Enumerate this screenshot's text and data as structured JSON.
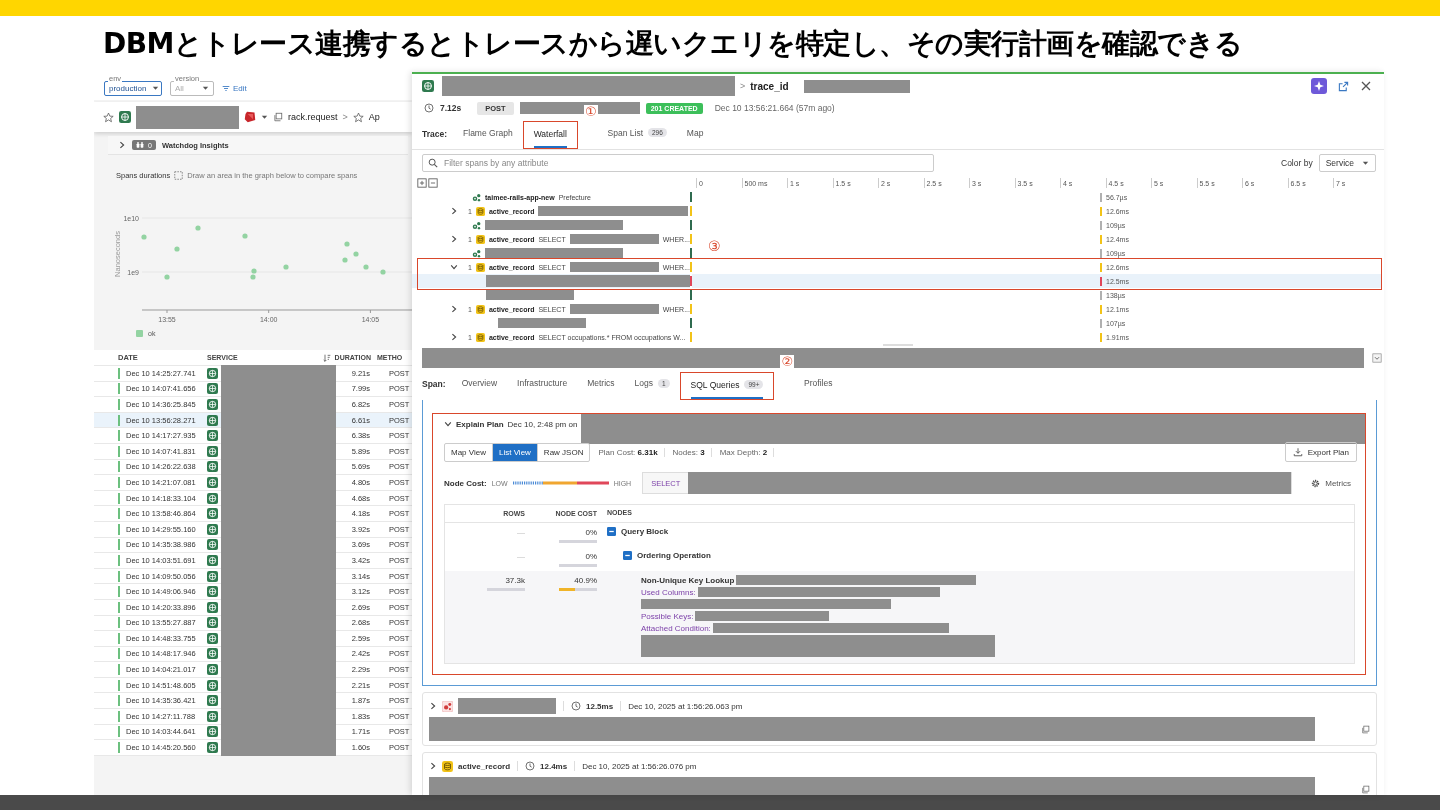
{
  "slide": {
    "title": "DBMとトレース連携するとトレースから遅いクエリを特定し、その実行計画を確認できる"
  },
  "filters": {
    "env": {
      "label": "env",
      "value": "production"
    },
    "version": {
      "label": "version",
      "value": "All"
    },
    "edit": "Edit"
  },
  "service_header": {
    "operation": "rack.request",
    "separator": ">",
    "next": "Ap"
  },
  "watchdog": {
    "count": "0",
    "label": "Watchdog Insights"
  },
  "spans_chart": {
    "title": "Spans durations",
    "hint": "Draw an area in the graph below to compare spans",
    "y_label": "Nanoseconds",
    "y_ticks": [
      "1e10",
      "1e9"
    ],
    "x_ticks": [
      "13:55",
      "14:00",
      "14:05"
    ],
    "legend": [
      {
        "name": "ok",
        "color": "#93d3a2"
      }
    ]
  },
  "traces_table": {
    "columns": [
      "DATE",
      "SERVICE",
      "DURATION",
      "METHO"
    ],
    "rows": [
      {
        "date": "Dec 10 14:25:27.741",
        "duration": "9.21s",
        "method": "POST",
        "selected": false
      },
      {
        "date": "Dec 10 14:07:41.656",
        "duration": "7.99s",
        "method": "POST",
        "selected": false
      },
      {
        "date": "Dec 10 14:36:25.845",
        "duration": "6.82s",
        "method": "POST",
        "selected": false
      },
      {
        "date": "Dec 10 13:56:28.271",
        "duration": "6.61s",
        "method": "POST",
        "selected": true
      },
      {
        "date": "Dec 10 14:17:27.935",
        "duration": "6.38s",
        "method": "POST",
        "selected": false
      },
      {
        "date": "Dec 10 14:07:41.831",
        "duration": "5.89s",
        "method": "POST",
        "selected": false
      },
      {
        "date": "Dec 10 14:26:22.638",
        "duration": "5.69s",
        "method": "POST",
        "selected": false
      },
      {
        "date": "Dec 10 14:21:07.081",
        "duration": "4.80s",
        "method": "POST",
        "selected": false
      },
      {
        "date": "Dec 10 14:18:33.104",
        "duration": "4.68s",
        "method": "POST",
        "selected": false
      },
      {
        "date": "Dec 10 13:58:46.864",
        "duration": "4.18s",
        "method": "POST",
        "selected": false
      },
      {
        "date": "Dec 10 14:29:55.160",
        "duration": "3.92s",
        "method": "POST",
        "selected": false
      },
      {
        "date": "Dec 10 14:35:38.986",
        "duration": "3.69s",
        "method": "POST",
        "selected": false
      },
      {
        "date": "Dec 10 14:03:51.691",
        "duration": "3.42s",
        "method": "POST",
        "selected": false
      },
      {
        "date": "Dec 10 14:09:50.056",
        "duration": "3.14s",
        "method": "POST",
        "selected": false
      },
      {
        "date": "Dec 10 14:49:06.946",
        "duration": "3.12s",
        "method": "POST",
        "selected": false
      },
      {
        "date": "Dec 10 14:20:33.896",
        "duration": "2.69s",
        "method": "POST",
        "selected": false
      },
      {
        "date": "Dec 10 13:55:27.887",
        "duration": "2.68s",
        "method": "POST",
        "selected": false
      },
      {
        "date": "Dec 10 14:48:33.755",
        "duration": "2.59s",
        "method": "POST",
        "selected": false
      },
      {
        "date": "Dec 10 14:48:17.946",
        "duration": "2.42s",
        "method": "POST",
        "selected": false
      },
      {
        "date": "Dec 10 14:04:21.017",
        "duration": "2.29s",
        "method": "POST",
        "selected": false
      },
      {
        "date": "Dec 10 14:51:48.605",
        "duration": "2.21s",
        "method": "POST",
        "selected": false
      },
      {
        "date": "Dec 10 14:35:36.421",
        "duration": "1.87s",
        "method": "POST",
        "selected": false
      },
      {
        "date": "Dec 10 14:27:11.788",
        "duration": "1.83s",
        "method": "POST",
        "selected": false
      },
      {
        "date": "Dec 10 14:03:44.641",
        "duration": "1.71s",
        "method": "POST",
        "selected": false
      },
      {
        "date": "Dec 10 14:45:20.560",
        "duration": "1.60s",
        "method": "POST",
        "selected": false
      }
    ]
  },
  "trace_panel": {
    "header": {
      "separator": ">",
      "trace_label": "trace_id"
    },
    "summary": {
      "duration": "7.12s",
      "method": "POST",
      "status": "201 CREATED",
      "timestamp": "Dec 10 13:56:21.664 (57m ago)"
    },
    "trace_tabs": {
      "label": "Trace:",
      "tabs": [
        {
          "label": "Flame Graph",
          "selected": false
        },
        {
          "label": "Waterfall",
          "selected": true,
          "annotation": "①"
        },
        {
          "label": "Span List",
          "count": "296",
          "selected": false
        },
        {
          "label": "Map",
          "selected": false
        }
      ]
    },
    "filter": {
      "placeholder": "Filter spans by any attribute"
    },
    "color_by": {
      "label": "Color by",
      "value": "Service"
    },
    "timeline_ticks": [
      "0",
      "500 ms",
      "1 s",
      "1.5 s",
      "2 s",
      "2.5 s",
      "3 s",
      "3.5 s",
      "4 s",
      "4.5 s",
      "5 s",
      "5.5 s",
      "6 s",
      "6.5 s",
      "7 s"
    ],
    "waterfall_rows": [
      {
        "kind": "service",
        "name": "taimee-rails-app-new",
        "query": "Prefecture",
        "redacted": false,
        "selected": false,
        "duration": "56.7µs",
        "color": "#b0b0b0"
      },
      {
        "kind": "span",
        "expanded": false,
        "count": "1",
        "name": "active_record",
        "redacted": true,
        "selected": false,
        "duration": "12.6ms",
        "color": "#f2c318"
      },
      {
        "kind": "service",
        "redacted": true,
        "selected": false,
        "duration": "109µs",
        "color": "#b0b0b0"
      },
      {
        "kind": "span",
        "expanded": false,
        "count": "1",
        "name": "active_record",
        "query": "SELECT",
        "redacted": true,
        "tail": "WHER...",
        "selected": false,
        "duration": "12.4ms",
        "color": "#f2c318"
      },
      {
        "kind": "service",
        "redacted": true,
        "selected": false,
        "duration": "109µs",
        "color": "#b0b0b0"
      },
      {
        "kind": "span",
        "expanded": true,
        "count": "1",
        "name": "active_record",
        "query": "SELECT",
        "redacted": true,
        "tail": "WHER...",
        "selected": false,
        "duration": "12.6ms",
        "color": "#f2c318",
        "annotation": "③",
        "children": [
          {
            "kind": "child",
            "redacted": true,
            "selected": true,
            "duration": "12.5ms",
            "color": "#e0475a"
          },
          {
            "kind": "child",
            "redacted": true,
            "selected": false,
            "duration": "138µs",
            "color": "#b0b0b0"
          }
        ]
      },
      {
        "kind": "span",
        "expanded": false,
        "count": "1",
        "name": "active_record",
        "query": "SELECT",
        "redacted": true,
        "tail": "WHER...",
        "selected": false,
        "duration": "12.1ms",
        "color": "#f2c318"
      },
      {
        "kind": "child",
        "redacted": true,
        "selected": false,
        "duration": "107µs",
        "color": "#b0b0b0"
      },
      {
        "kind": "span",
        "expanded": false,
        "count": "1",
        "name": "active_record",
        "query": "SELECT occupations.* FROM occupations W...",
        "redacted": false,
        "selected": false,
        "duration": "1.91ms",
        "color": "#f2c318"
      }
    ],
    "span_tabs": {
      "label": "Span:",
      "tabs": [
        {
          "label": "Overview",
          "selected": false
        },
        {
          "label": "Infrastructure",
          "selected": false
        },
        {
          "label": "Metrics",
          "selected": false
        },
        {
          "label": "Logs",
          "count": "1",
          "selected": false
        },
        {
          "label": "SQL Queries",
          "count": "99+",
          "selected": true,
          "annotation": "②"
        },
        {
          "label": "Profiles",
          "selected": false
        }
      ]
    },
    "explain_plan": {
      "title": "Explain Plan",
      "date": "Dec 10, 2:48 pm on",
      "views": [
        {
          "label": "Map View",
          "selected": false
        },
        {
          "label": "List View",
          "selected": true
        },
        {
          "label": "Raw JSON",
          "selected": false
        }
      ],
      "stats": [
        {
          "label": "Plan Cost:",
          "value": "6.31k"
        },
        {
          "label": "Nodes:",
          "value": "3"
        },
        {
          "label": "Max Depth:",
          "value": "2"
        }
      ],
      "export": "Export Plan",
      "node_cost": {
        "label": "Node Cost:",
        "low": "LOW",
        "high": "HIGH"
      },
      "query_keyword": "SELECT",
      "metrics": "Metrics",
      "columns": [
        "ROWS",
        "NODE COST",
        "NODES"
      ],
      "nodes": [
        {
          "kind": "operation",
          "rows": "—",
          "cost": "0%",
          "level": 0,
          "name": "Query Block",
          "expanded": true,
          "children": [
            {
              "kind": "operation",
              "rows": "—",
              "cost": "0%",
              "level": 0,
              "name": "Ordering Operation",
              "expanded": true,
              "children": [
                {
                  "kind": "lookup",
                  "rows": "37.3k",
                  "cost": "40.9%",
                  "level": 0.409,
                  "name": "Non-Unique Key Lookup",
                  "details": [
                    {
                      "label": "Used Columns:",
                      "kind": "wrapped"
                    },
                    {
                      "label": "Possible Keys:",
                      "kind": "single"
                    },
                    {
                      "label": "Attached Condition:",
                      "kind": "block"
                    }
                  ]
                }
              ]
            }
          ]
        }
      ]
    },
    "span_cards": [
      {
        "kind": "service",
        "duration": "12.5ms",
        "timestamp": "Dec 10, 2025 at 1:56:26.063 pm"
      },
      {
        "kind": "db",
        "name": "active_record",
        "duration": "12.4ms",
        "timestamp": "Dec 10, 2025 at 1:56:26.076 pm"
      }
    ]
  }
}
